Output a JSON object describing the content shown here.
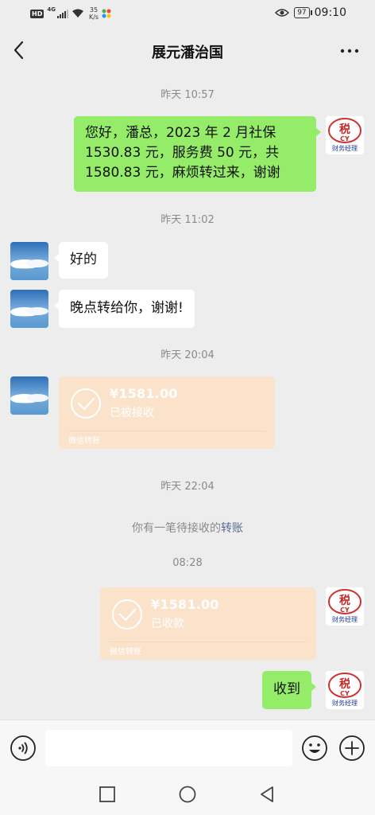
{
  "status_bar": {
    "hd": "HD",
    "network": "4G",
    "speed_value": "35",
    "speed_unit": "K/s",
    "battery": "97",
    "clock": "09:10"
  },
  "header": {
    "title": "展元潘治国",
    "back_icon": "chevron-left-icon",
    "more_icon": "more-dots-icon"
  },
  "me": {
    "avatar_text_cn": "税",
    "avatar_text_en": "CY",
    "avatar_caption": "财务经理"
  },
  "messages": {
    "t1": "昨天 10:57",
    "m1_line1": "您好，潘总，2023 年 2 月社保",
    "m1_line2": "1530.83 元，服务费 50 元，共",
    "m1_line3": "1580.83 元，麻烦转过来，谢谢",
    "t2": "昨天 11:02",
    "m2": "好的",
    "m3": "晚点转给你，谢谢!",
    "t3": "昨天 20:04",
    "transfer1": {
      "amount": "¥1581.00",
      "status": "已被接收",
      "label": "微信转账"
    },
    "t4": "昨天 22:04",
    "system_prefix": "你有一笔待接收的",
    "system_link": "转账",
    "t5": "08:28",
    "transfer2": {
      "amount": "¥1581.00",
      "status": "已收款",
      "label": "微信转账"
    },
    "m4": "收到"
  },
  "input_bar": {
    "placeholder": "",
    "voice_icon": "voice-icon",
    "emoji_icon": "emoji-icon",
    "plus_icon": "plus-icon"
  },
  "system_nav": {
    "recent_icon": "square-icon",
    "home_icon": "circle-icon",
    "back_icon": "triangle-back-icon"
  },
  "colors": {
    "background": "#ededed",
    "bubble_me": "#95ec69",
    "bubble_other": "#ffffff",
    "transfer_card": "#fbe3cb",
    "link": "#576b95",
    "timestamp": "#8a8a8a"
  }
}
